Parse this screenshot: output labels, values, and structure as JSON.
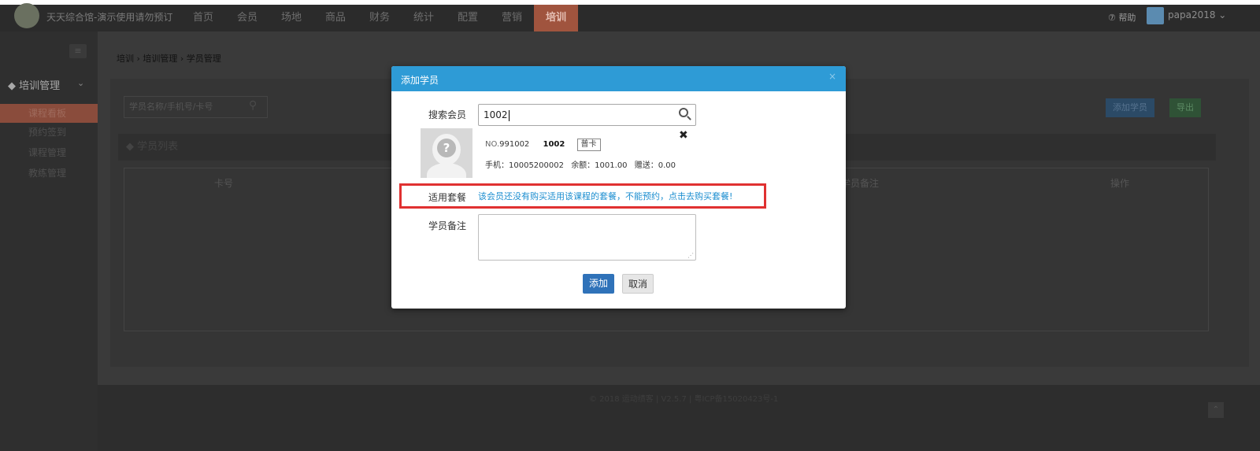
{
  "topbar": {
    "site_name": "天天综合馆-演示使用请勿预订",
    "nav": [
      "首页",
      "会员",
      "场地",
      "商品",
      "财务",
      "统计",
      "配置",
      "营销",
      "培训"
    ],
    "active_nav": "培训",
    "help": "⑦ 帮助",
    "username": "papa2018 ⌄"
  },
  "sidebar": {
    "group": "培训管理",
    "items": [
      {
        "label": "课程看板"
      },
      {
        "label": "预约签到"
      },
      {
        "label": "课程管理"
      },
      {
        "label": "教练管理"
      }
    ]
  },
  "main": {
    "breadcrumb": "培训 › 培训管理 › 学员管理",
    "search_placeholder": "学员名称/手机号/卡号",
    "add_student_label": "添加学员",
    "export_label": "导出",
    "list_title": "学员列表",
    "columns": [
      "卡号",
      "学员备注",
      "操作"
    ],
    "footer": "© 2018 运动绩客 | V2.5.7 | 粤ICP备15020423号-1"
  },
  "modal": {
    "title": "添加学员",
    "close": "×",
    "search_member_label": "搜索会员",
    "search_value": "1002",
    "member": {
      "no_prefix": "NO.",
      "no": "991002",
      "card_name": "1002",
      "card_type": "普卡",
      "phone": "手机：10005200002",
      "balance": "余额：1001.00",
      "gift": "赠送：0.00"
    },
    "package_label": "适用套餐",
    "package_warning": "该会员还没有购买适用该课程的套餐，不能预约，点击去购买套餐!",
    "remark_label": "学员备注",
    "remark_value": "",
    "submit_label": "添加",
    "cancel_label": "取消"
  },
  "colors": {
    "modal_header": "#2e9bd6",
    "highlight_border": "#e03131",
    "primary_button": "#2f72b9",
    "warning_text": "#1c8ed0"
  }
}
